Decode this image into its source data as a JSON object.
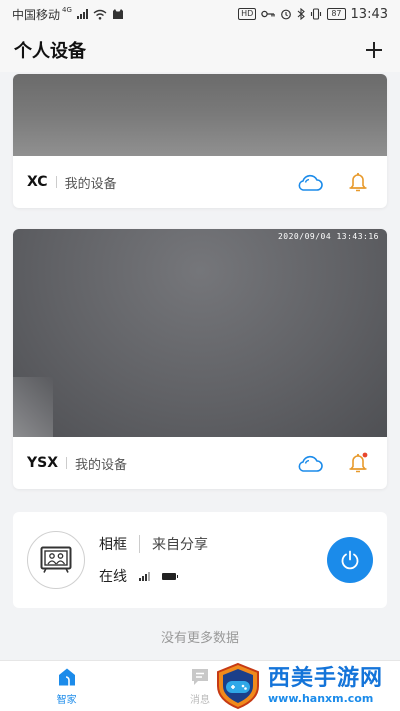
{
  "status_bar": {
    "carrier": "中国移动",
    "network": "4G",
    "hd": "HD",
    "battery": "87",
    "time": "13:43"
  },
  "header": {
    "title": "个人设备"
  },
  "devices": [
    {
      "name": "XC",
      "owner": "我的设备",
      "timestamp": ""
    },
    {
      "name": "YSX",
      "owner": "我的设备",
      "timestamp": "2020/09/04 13:43:16"
    }
  ],
  "shared": {
    "name": "相框",
    "source": "来自分享",
    "status": "在线"
  },
  "list_end": "没有更多数据",
  "tabs": [
    {
      "label": "智家"
    },
    {
      "label": "消息"
    }
  ],
  "colors": {
    "accent": "#1b8bea",
    "bell": "#e89a2c",
    "alert_dot": "#e8462c"
  },
  "watermark": {
    "title": "西美手游网",
    "url": "www.hanxm.com"
  }
}
